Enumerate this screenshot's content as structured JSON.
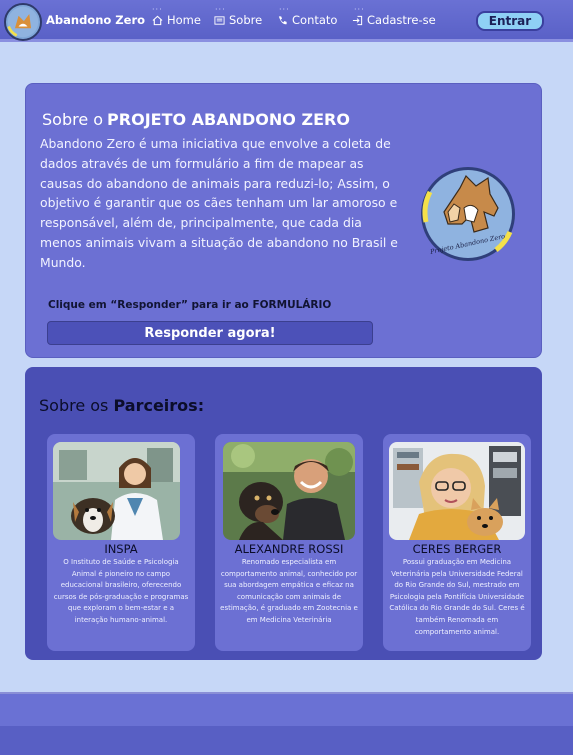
{
  "nav": {
    "brand": "Abandono Zero",
    "links": [
      {
        "label": "Home",
        "icon": "home-icon"
      },
      {
        "label": "Sobre",
        "icon": "list-icon"
      },
      {
        "label": "Contato",
        "icon": "phone-icon"
      },
      {
        "label": "Cadastre-se",
        "icon": "login-icon"
      }
    ],
    "login_label": "Entrar"
  },
  "about": {
    "title_prefix": "Sobre o",
    "title_strong": "PROJETO ABANDONO ZERO",
    "text": "Abandono Zero é uma iniciativa que envolve a coleta de dados através de um formulário a fim de mapear as causas do abandono de animais para reduzi-lo; Assim, o objetivo é garantir que os cães tenham um lar amoroso e responsável, além de, principalmente, que cada dia menos animais vivam a situação de abandono no Brasil e Mundo.",
    "logo_caption": "Projeto Abandono Zero",
    "cta_hint": "Clique em “Responder” para ir ao",
    "cta_hint_strong": "FORMULÁRIO",
    "cta_button": "Responder agora!"
  },
  "partners": {
    "title_prefix": "Sobre os",
    "title_strong": "Parceiros:",
    "items": [
      {
        "name": "INSPA",
        "description": "O Instituto de Saúde e Psicologia Animal é pioneiro no campo educacional brasileiro, oferecendo cursos de pós-graduação e programas que exploram o bem-estar e a interação humano-animal."
      },
      {
        "name": "ALEXANDRE ROSSI",
        "description": "Renomado especialista em comportamento animal, conhecido por sua abordagem empática e eficaz na comunicação com animais de estimação, é graduado em Zootecnia e em Medicina Veterinária"
      },
      {
        "name": "CERES BERGER",
        "description": "Possui graduação em Medicina Veterinária pela Universidade Federal do Rio Grande do Sul, mestrado em Psicologia pela Pontifícia Universidade Católica do Rio Grande do Sul. Ceres é também Renomada em comportamento animal."
      }
    ]
  }
}
